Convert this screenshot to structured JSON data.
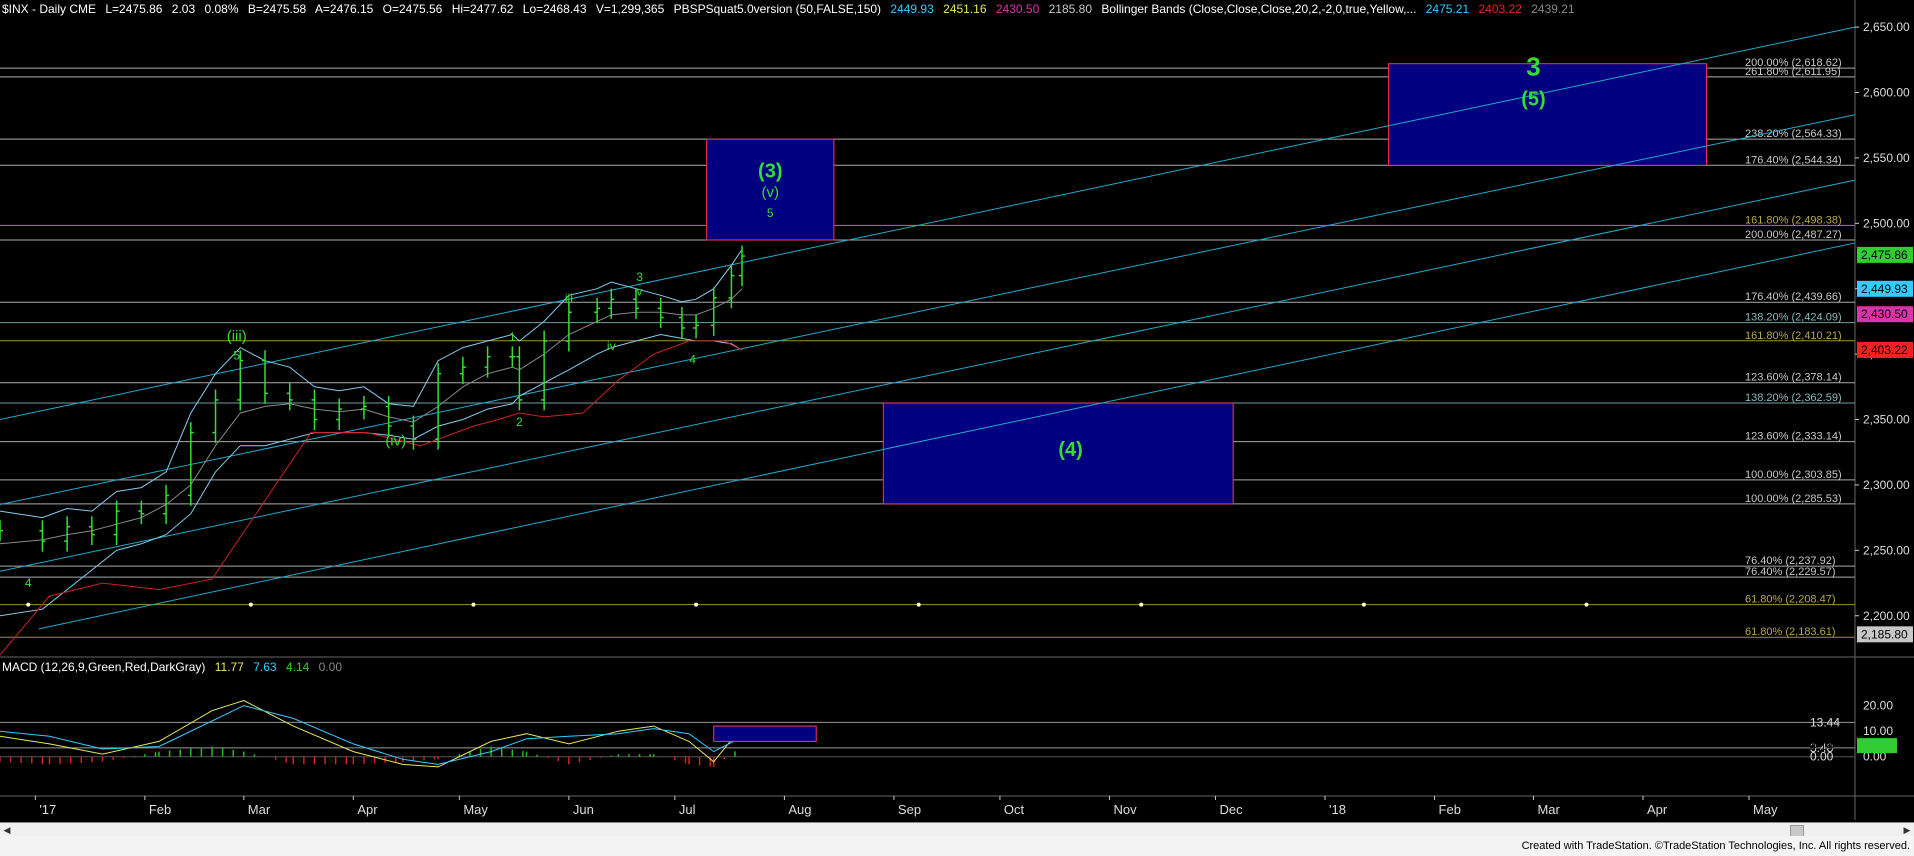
{
  "header": {
    "symbol": "$INX - Daily  CME",
    "last": "L=2475.86",
    "change": "2.03",
    "change_pct": "0.08%",
    "bid": "B=2475.58",
    "ask": "A=2476.15",
    "open": "O=2475.56",
    "high": "Hi=2477.62",
    "low": "Lo=2468.43",
    "volume": "V=1,299,365",
    "indicator": "PBSPSquat5.0version (50,FALSE,150)",
    "ind_v1": "2449.93",
    "ind_v2": "2451.16",
    "ind_v3": "2430.50",
    "ind_v4": "2185.80",
    "bb_label": "Bollinger Bands (Close,Close,Close,20,2,-2,0,true,Yellow,...",
    "bb_v1": "2475.21",
    "bb_v2": "2403.22",
    "bb_v3": "2439.21"
  },
  "macd_header": {
    "label": "MACD (12,26,9,Green,Red,DarkGray)",
    "v1": "11.77",
    "v2": "7.63",
    "v3": "4.14",
    "v4": "0.00"
  },
  "footer": {
    "credit": "Created with TradeStation. ©TradeStation Technologies, Inc. All rights reserved."
  },
  "colors": {
    "background": "#000000",
    "box_fill": "#000080",
    "box_border": "#ff3355",
    "wave_green": "#33dd33",
    "channel": "#22aacc"
  },
  "chart_data": {
    "type": "candlestick",
    "price_ylim": [
      2170,
      2660
    ],
    "price_ticks": [
      "2,650.00",
      "2,600.00",
      "2,550.00",
      "2,500.00",
      "2,450.00",
      "2,400.00",
      "2,350.00",
      "2,300.00",
      "2,250.00",
      "2,200.00"
    ],
    "x_labels": [
      "'17",
      "Feb",
      "Mar",
      "Apr",
      "May",
      "Jun",
      "Jul",
      "Aug",
      "Sep",
      "Oct",
      "Nov",
      "Dec",
      "'18",
      "Feb",
      "Mar",
      "Apr",
      "May"
    ],
    "fib_levels": [
      {
        "label": "200.00% (2,618.62)",
        "value": 2618.62,
        "color": "#c8c8c8"
      },
      {
        "label": "261.80% (2,611.95)",
        "value": 2611.95,
        "color": "#c8c8c8"
      },
      {
        "label": "238.20% (2,564.33)",
        "value": 2564.33,
        "color": "#c8c8c8"
      },
      {
        "label": "176.40% (2,544.34)",
        "value": 2544.34,
        "color": "#c8c8c8"
      },
      {
        "label": "161.80% (2,498.38)",
        "value": 2498.38,
        "color": "#b8a848"
      },
      {
        "label": "200.00% (2,487.27)",
        "value": 2487.27,
        "color": "#c8c8c8"
      },
      {
        "label": "176.40% (2,439.66)",
        "value": 2439.66,
        "color": "#c8c8c8"
      },
      {
        "label": "138.20% (2,424.09)",
        "value": 2424.09,
        "color": "#88bbbb"
      },
      {
        "label": "161.80% (2,410.21)",
        "value": 2410.21,
        "color": "#b8a848"
      },
      {
        "label": "123.60% (2,378.14)",
        "value": 2378.14,
        "color": "#c8c8c8"
      },
      {
        "label": "138.20% (2,362.59)",
        "value": 2362.59,
        "color": "#88bbbb"
      },
      {
        "label": "123.60% (2,333.14)",
        "value": 2333.14,
        "color": "#c8c8c8"
      },
      {
        "label": "100.00% (2,303.85)",
        "value": 2303.85,
        "color": "#c8c8c8"
      },
      {
        "label": "100.00% (2,285.53)",
        "value": 2285.53,
        "color": "#c8c8c8"
      },
      {
        "label": "76.40% (2,237.92)",
        "value": 2237.92,
        "color": "#c8c8c8"
      },
      {
        "label": "76.40% (2,229.57)",
        "value": 2229.57,
        "color": "#c8c8c8"
      },
      {
        "label": "61.80% (2,208.47)",
        "value": 2208.47,
        "color": "#b8a848"
      },
      {
        "label": "61.80% (2,183.61)",
        "value": 2183.61,
        "color": "#b8a848"
      }
    ],
    "axis_badges": [
      {
        "text": "2,475.86",
        "value": 2475.86,
        "bg": "#33cc33",
        "fg": "#000"
      },
      {
        "text": "2,449.93",
        "value": 2449.93,
        "bg": "#33ccff",
        "fg": "#000"
      },
      {
        "text": "2,430.50",
        "value": 2430.5,
        "bg": "#dd33aa",
        "fg": "#000"
      },
      {
        "text": "2,403.22",
        "value": 2403.22,
        "bg": "#ee2222",
        "fg": "#000"
      },
      {
        "text": "2,185.80",
        "value": 2185.8,
        "bg": "#c8c8c8",
        "fg": "#000"
      }
    ],
    "target_boxes": [
      {
        "name": "wave-3-box",
        "x0": "2017-07-10",
        "x1": "2017-08-15",
        "y0": 2487.27,
        "y1": 2564.33
      },
      {
        "name": "wave-4-box",
        "x0": "2017-08-29",
        "x1": "2017-12-06",
        "y0": 2285.53,
        "y1": 2362.59
      },
      {
        "name": "wave-5-box",
        "x0": "2018-01-19",
        "x1": "2018-04-19",
        "y0": 2544.34,
        "y1": 2622.0
      }
    ],
    "wave_labels": [
      {
        "text": "3",
        "x": "2018-03-01",
        "y": 2613,
        "size": "big"
      },
      {
        "text": "(5)",
        "x": "2018-03-01",
        "y": 2590,
        "size": "mid"
      },
      {
        "text": "(3)",
        "x": "2017-07-28",
        "y": 2535,
        "size": "mid"
      },
      {
        "text": "(v)",
        "x": "2017-07-28",
        "y": 2520,
        "size": "small"
      },
      {
        "text": "5",
        "x": "2017-07-28",
        "y": 2505,
        "size": "tiny"
      },
      {
        "text": "(4)",
        "x": "2017-10-21",
        "y": 2322,
        "size": "mid"
      },
      {
        "text": "(iii)",
        "x": "2017-02-27",
        "y": 2410,
        "size": "small"
      },
      {
        "text": "5",
        "x": "2017-02-27",
        "y": 2396,
        "size": "tiny"
      },
      {
        "text": "(iv)",
        "x": "2017-04-13",
        "y": 2330,
        "size": "small"
      },
      {
        "text": "1",
        "x": "2017-05-16",
        "y": 2410,
        "size": "tiny"
      },
      {
        "text": "2",
        "x": "2017-05-18",
        "y": 2345,
        "size": "tiny"
      },
      {
        "text": "iii",
        "x": "2017-06-01",
        "y": 2440,
        "size": "tiny"
      },
      {
        "text": "iv",
        "x": "2017-06-13",
        "y": 2403,
        "size": "tiny"
      },
      {
        "text": "3",
        "x": "2017-06-21",
        "y": 2456,
        "size": "tiny"
      },
      {
        "text": "v",
        "x": "2017-06-21",
        "y": 2445,
        "size": "tiny"
      },
      {
        "text": "4",
        "x": "2017-07-06",
        "y": 2393,
        "size": "tiny"
      },
      {
        "text": "4",
        "x": "2016-12-30",
        "y": 2222,
        "size": "tiny"
      }
    ],
    "channel_lines": [
      {
        "x0": "2016-12-22",
        "y0": 2350,
        "x1": "2018-05-31",
        "y1": 2650
      },
      {
        "x0": "2016-12-22",
        "y0": 2285,
        "x1": "2018-05-31",
        "y1": 2583
      },
      {
        "x0": "2016-12-22",
        "y0": 2234,
        "x1": "2018-05-31",
        "y1": 2533
      },
      {
        "x0": "2017-01-02",
        "y0": 2190,
        "x1": "2018-05-31",
        "y1": 2485
      }
    ],
    "price_series": {
      "dates": [
        "2016-12-22",
        "2017-01-03",
        "2017-01-10",
        "2017-01-17",
        "2017-01-24",
        "2017-01-31",
        "2017-02-07",
        "2017-02-14",
        "2017-02-21",
        "2017-02-28",
        "2017-03-07",
        "2017-03-14",
        "2017-03-21",
        "2017-03-28",
        "2017-04-04",
        "2017-04-11",
        "2017-04-18",
        "2017-04-25",
        "2017-05-02",
        "2017-05-09",
        "2017-05-16",
        "2017-05-18",
        "2017-05-25",
        "2017-06-01",
        "2017-06-09",
        "2017-06-13",
        "2017-06-20",
        "2017-06-27",
        "2017-07-03",
        "2017-07-07",
        "2017-07-12",
        "2017-07-17",
        "2017-07-20"
      ],
      "close": [
        2265,
        2257,
        2268,
        2262,
        2280,
        2278,
        2292,
        2340,
        2365,
        2395,
        2370,
        2365,
        2350,
        2358,
        2360,
        2345,
        2335,
        2385,
        2390,
        2398,
        2398,
        2365,
        2410,
        2432,
        2435,
        2442,
        2435,
        2428,
        2420,
        2422,
        2443,
        2460,
        2475
      ]
    },
    "bollinger": {
      "upper": [
        2280,
        2275,
        2282,
        2280,
        2295,
        2298,
        2310,
        2355,
        2385,
        2405,
        2395,
        2390,
        2375,
        2372,
        2375,
        2362,
        2360,
        2395,
        2405,
        2410,
        2415,
        2410,
        2425,
        2445,
        2450,
        2455,
        2450,
        2445,
        2440,
        2442,
        2450,
        2468,
        2480
      ],
      "mid": [
        2255,
        2258,
        2262,
        2265,
        2270,
        2275,
        2285,
        2300,
        2330,
        2355,
        2360,
        2362,
        2358,
        2356,
        2358,
        2352,
        2348,
        2360,
        2375,
        2385,
        2390,
        2388,
        2400,
        2415,
        2425,
        2430,
        2432,
        2432,
        2430,
        2430,
        2435,
        2442,
        2450
      ],
      "lower": [
        2200,
        2205,
        2220,
        2235,
        2250,
        2255,
        2262,
        2278,
        2310,
        2330,
        2330,
        2335,
        2340,
        2340,
        2340,
        2338,
        2335,
        2345,
        2350,
        2358,
        2362,
        2368,
        2378,
        2388,
        2400,
        2405,
        2410,
        2415,
        2412,
        2410,
        2410,
        2408,
        2403
      ]
    },
    "slow_ma": {
      "dates": [
        "2016-12-22",
        "2017-01-05",
        "2017-01-20",
        "2017-02-05",
        "2017-02-20",
        "2017-03-05",
        "2017-03-20",
        "2017-04-05",
        "2017-04-20",
        "2017-05-05",
        "2017-05-12",
        "2017-05-18",
        "2017-05-25",
        "2017-06-05",
        "2017-06-15",
        "2017-06-25",
        "2017-07-05",
        "2017-07-15",
        "2017-07-20"
      ],
      "values": [
        2170,
        2215,
        2225,
        2220,
        2228,
        2280,
        2340,
        2340,
        2330,
        2345,
        2350,
        2355,
        2352,
        2355,
        2380,
        2400,
        2410,
        2410,
        2403
      ]
    },
    "macd": {
      "ylim": [
        -15,
        32
      ],
      "ticks": [
        "20.00",
        "10.00",
        "0.00"
      ],
      "badges": [
        {
          "text": "13.44",
          "value": 13.44,
          "bg": "#000",
          "fg": "#ddd"
        },
        {
          "text": "3.48",
          "value": 3.48,
          "bg": "#000",
          "fg": "#ddd"
        },
        {
          "text": "4.14",
          "value": 4.14,
          "bg": "#33cc33",
          "fg": "#000"
        },
        {
          "text": "0.00",
          "value": 0.0,
          "bg": "#000",
          "fg": "#ddd"
        }
      ],
      "dates": [
        "2016-12-22",
        "2017-01-05",
        "2017-01-20",
        "2017-02-05",
        "2017-02-20",
        "2017-03-01",
        "2017-03-15",
        "2017-04-01",
        "2017-04-15",
        "2017-04-25",
        "2017-05-10",
        "2017-05-20",
        "2017-06-01",
        "2017-06-15",
        "2017-06-25",
        "2017-07-05",
        "2017-07-12",
        "2017-07-20"
      ],
      "macd": [
        8,
        5,
        1,
        6,
        18,
        22,
        12,
        2,
        -3,
        -4,
        6,
        9,
        5,
        10,
        12,
        6,
        -2,
        11.77
      ],
      "signal": [
        10,
        8,
        3,
        4,
        14,
        20,
        15,
        5,
        -1,
        -3,
        2,
        7,
        8,
        9,
        11,
        9,
        2,
        7.63
      ],
      "box": {
        "x0": "2017-07-12",
        "x1": "2017-08-10",
        "y0": 6.0,
        "y1": 12.0
      }
    }
  }
}
